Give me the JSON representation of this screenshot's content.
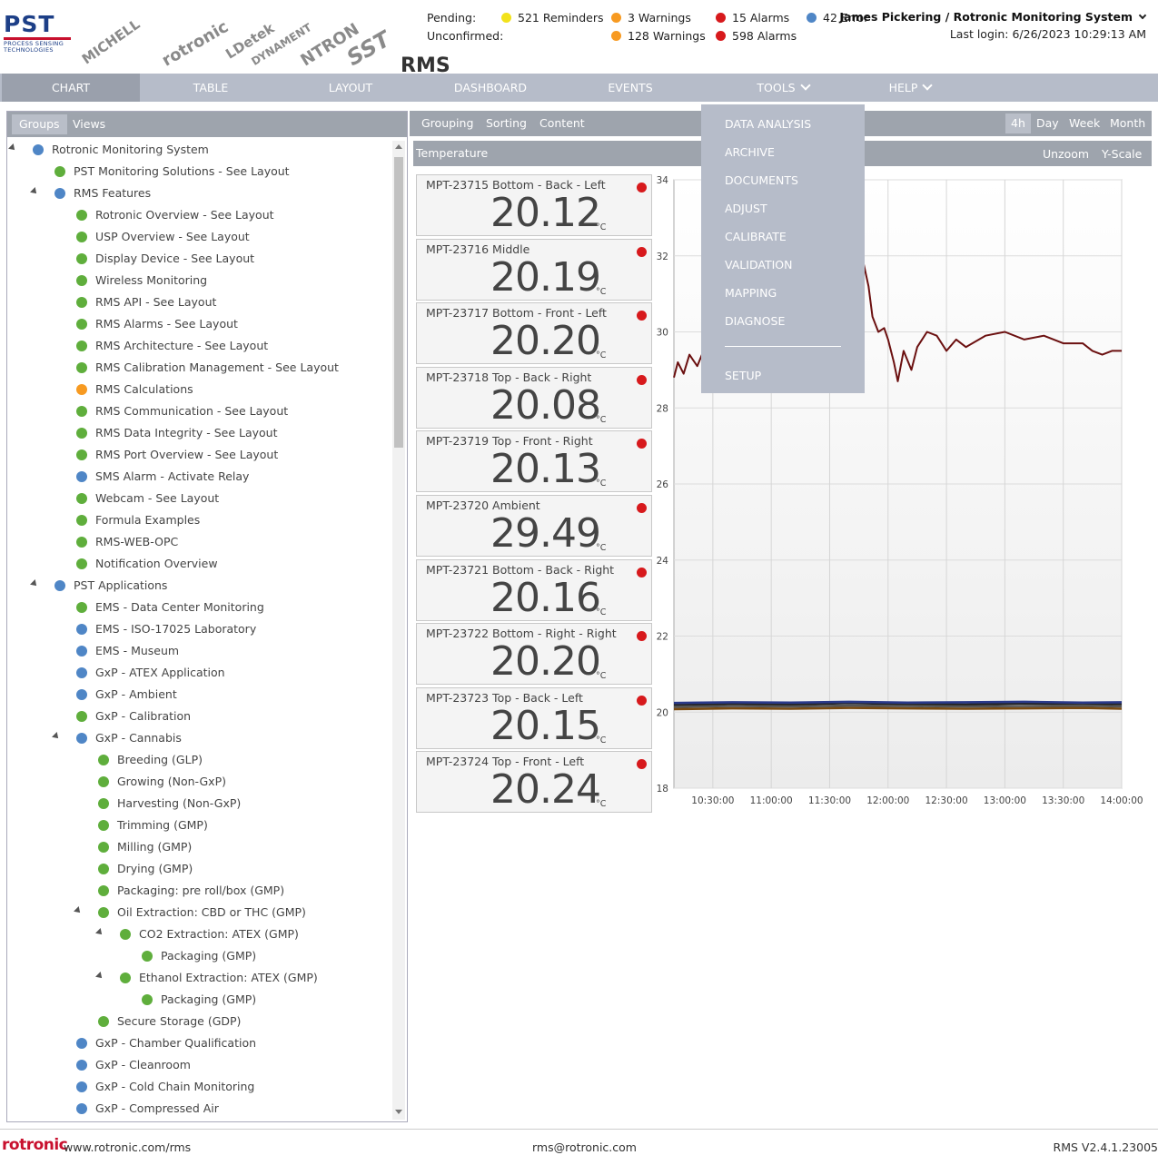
{
  "header": {
    "rms_title": "RMS",
    "pst_logo": {
      "name": "PST",
      "line1": "PROCESS SENSING",
      "line2": "TECHNOLOGIES"
    },
    "brand_logos": [
      "MICHELL",
      "rotronic",
      "LDetek",
      "DYNAMENT",
      "NTRON",
      "SST"
    ],
    "pending_label": "Pending:",
    "unconfirmed_label": "Unconfirmed:",
    "pending": {
      "reminders": "521 Reminders",
      "warnings": "3 Warnings",
      "alarms": "15 Alarms",
      "errors": "42 Error"
    },
    "unconfirmed": {
      "warnings": "128 Warnings",
      "alarms": "598 Alarms"
    },
    "user": "James Pickering / Rotronic Monitoring System",
    "last_login": "Last login: 6/26/2023 10:29:13 AM"
  },
  "colors": {
    "reminder": "#f2e21b",
    "warning": "#f79a21",
    "alarm": "#d7191c",
    "error": "#4f86c6",
    "ok": "#5fae3c",
    "nav": "#b6bcc9",
    "nav_active": "#9aa0ac"
  },
  "nav": {
    "chart": "CHART",
    "table": "TABLE",
    "layout": "LAYOUT",
    "dashboard": "DASHBOARD",
    "events": "EVENTS",
    "tools": "TOOLS",
    "help": "HELP"
  },
  "left_tabs": {
    "groups": "Groups",
    "views": "Views"
  },
  "tree": [
    {
      "label": "Rotronic Monitoring System",
      "level": 0,
      "status": "error",
      "expanded": true
    },
    {
      "label": "PST Monitoring Solutions - See Layout",
      "level": 1,
      "status": "ok"
    },
    {
      "label": "RMS Features",
      "level": 1,
      "status": "error",
      "expanded": true
    },
    {
      "label": "Rotronic Overview - See Layout",
      "level": 2,
      "status": "ok"
    },
    {
      "label": "USP Overview - See Layout",
      "level": 2,
      "status": "ok"
    },
    {
      "label": "Display Device - See Layout",
      "level": 2,
      "status": "ok"
    },
    {
      "label": "Wireless Monitoring",
      "level": 2,
      "status": "ok"
    },
    {
      "label": "RMS API - See Layout",
      "level": 2,
      "status": "ok"
    },
    {
      "label": "RMS Alarms - See Layout",
      "level": 2,
      "status": "ok"
    },
    {
      "label": "RMS Architecture - See Layout",
      "level": 2,
      "status": "ok"
    },
    {
      "label": "RMS Calibration Management - See Layout",
      "level": 2,
      "status": "ok"
    },
    {
      "label": "RMS Calculations",
      "level": 2,
      "status": "warning"
    },
    {
      "label": "RMS Communication - See Layout",
      "level": 2,
      "status": "ok"
    },
    {
      "label": "RMS Data Integrity - See Layout",
      "level": 2,
      "status": "ok"
    },
    {
      "label": "RMS Port Overview - See Layout",
      "level": 2,
      "status": "ok"
    },
    {
      "label": "SMS Alarm - Activate Relay",
      "level": 2,
      "status": "error"
    },
    {
      "label": "Webcam - See Layout",
      "level": 2,
      "status": "ok"
    },
    {
      "label": "Formula Examples",
      "level": 2,
      "status": "ok"
    },
    {
      "label": "RMS-WEB-OPC",
      "level": 2,
      "status": "ok"
    },
    {
      "label": "Notification Overview",
      "level": 2,
      "status": "ok"
    },
    {
      "label": "PST Applications",
      "level": 1,
      "status": "error",
      "expanded": true
    },
    {
      "label": "EMS - Data Center Monitoring",
      "level": 2,
      "status": "ok"
    },
    {
      "label": "EMS - ISO-17025 Laboratory",
      "level": 2,
      "status": "error"
    },
    {
      "label": "EMS - Museum",
      "level": 2,
      "status": "error"
    },
    {
      "label": "GxP - ATEX Application",
      "level": 2,
      "status": "error"
    },
    {
      "label": "GxP - Ambient",
      "level": 2,
      "status": "error"
    },
    {
      "label": "GxP - Calibration",
      "level": 2,
      "status": "ok"
    },
    {
      "label": "GxP - Cannabis",
      "level": 2,
      "status": "error",
      "expanded": true
    },
    {
      "label": "Breeding (GLP)",
      "level": 3,
      "status": "ok"
    },
    {
      "label": "Growing (Non-GxP)",
      "level": 3,
      "status": "ok"
    },
    {
      "label": "Harvesting (Non-GxP)",
      "level": 3,
      "status": "ok"
    },
    {
      "label": "Trimming (GMP)",
      "level": 3,
      "status": "ok"
    },
    {
      "label": "Milling (GMP)",
      "level": 3,
      "status": "ok"
    },
    {
      "label": "Drying (GMP)",
      "level": 3,
      "status": "ok"
    },
    {
      "label": "Packaging: pre roll/box (GMP)",
      "level": 3,
      "status": "ok"
    },
    {
      "label": "Oil Extraction: CBD or THC (GMP)",
      "level": 3,
      "status": "ok",
      "expanded": true
    },
    {
      "label": "CO2 Extraction: ATEX (GMP)",
      "level": 4,
      "status": "ok",
      "expanded": true
    },
    {
      "label": "Packaging (GMP)",
      "level": 5,
      "status": "ok"
    },
    {
      "label": "Ethanol Extraction: ATEX (GMP)",
      "level": 4,
      "status": "ok",
      "expanded": true
    },
    {
      "label": "Packaging (GMP)",
      "level": 5,
      "status": "ok"
    },
    {
      "label": "Secure Storage (GDP)",
      "level": 3,
      "status": "ok"
    },
    {
      "label": "GxP - Chamber Qualification",
      "level": 2,
      "status": "error"
    },
    {
      "label": "GxP - Cleanroom",
      "level": 2,
      "status": "error"
    },
    {
      "label": "GxP - Cold Chain Monitoring",
      "level": 2,
      "status": "error"
    },
    {
      "label": "GxP - Compressed Air",
      "level": 2,
      "status": "error"
    }
  ],
  "toolbar": {
    "grouping": "Grouping",
    "sorting": "Sorting",
    "content": "Content",
    "r4h": "4h",
    "day": "Day",
    "week": "Week",
    "month": "Month"
  },
  "chartbar": {
    "title": "Temperature",
    "unzoom": "Unzoom",
    "yscale": "Y-Scale"
  },
  "cards": [
    {
      "name": "MPT-23715 Bottom - Back - Left",
      "value": "20.12",
      "unit": "°C"
    },
    {
      "name": "MPT-23716 Middle",
      "value": "20.19",
      "unit": "°C"
    },
    {
      "name": "MPT-23717 Bottom - Front - Left",
      "value": "20.20",
      "unit": "°C"
    },
    {
      "name": "MPT-23718 Top - Back - Right",
      "value": "20.08",
      "unit": "°C"
    },
    {
      "name": "MPT-23719 Top - Front - Right",
      "value": "20.13",
      "unit": "°C"
    },
    {
      "name": "MPT-23720 Ambient",
      "value": "29.49",
      "unit": "°C"
    },
    {
      "name": "MPT-23721 Bottom - Back - Right",
      "value": "20.16",
      "unit": "°C"
    },
    {
      "name": "MPT-23722 Bottom - Right - Right",
      "value": "20.20",
      "unit": "°C"
    },
    {
      "name": "MPT-23723 Top - Back - Left",
      "value": "20.15",
      "unit": "°C"
    },
    {
      "name": "MPT-23724 Top - Front - Left",
      "value": "20.24",
      "unit": "°C"
    }
  ],
  "chart_data": {
    "type": "line",
    "ylim": [
      18,
      34
    ],
    "yticks": [
      18,
      20,
      22,
      24,
      26,
      28,
      30,
      32,
      34
    ],
    "xlim": [
      "10:10:00",
      "14:00:00"
    ],
    "xticks": [
      "10:30:00",
      "11:00:00",
      "11:30:00",
      "12:00:00",
      "12:30:00",
      "13:00:00",
      "13:30:00",
      "14:00:00"
    ],
    "grid": true,
    "series": [
      {
        "color": "#6b1010",
        "x": [
          "10:10:00",
          "10:12:00",
          "10:15:00",
          "10:18:00",
          "10:22:00",
          "10:26:00",
          "11:45:00",
          "11:47:00",
          "11:50:00",
          "11:52:00",
          "11:55:00",
          "11:58:00",
          "12:00:00",
          "12:03:00",
          "12:05:00",
          "12:08:00",
          "12:12:00",
          "12:15:00",
          "12:20:00",
          "12:25:00",
          "12:30:00",
          "12:35:00",
          "12:40:00",
          "12:50:00",
          "13:00:00",
          "13:10:00",
          "13:20:00",
          "13:30:00",
          "13:40:00",
          "13:45:00",
          "13:50:00",
          "13:55:00",
          "14:00:00"
        ],
        "values": [
          28.8,
          29.2,
          28.9,
          29.4,
          29.1,
          29.6,
          32.3,
          31.9,
          31.2,
          30.4,
          30.0,
          30.1,
          29.8,
          29.2,
          28.7,
          29.5,
          29.0,
          29.6,
          30.0,
          29.9,
          29.5,
          29.8,
          29.6,
          29.9,
          30.0,
          29.8,
          29.9,
          29.7,
          29.7,
          29.5,
          29.4,
          29.5,
          29.5
        ]
      },
      {
        "color": "#222222",
        "x": [
          "10:10:00",
          "10:40:00",
          "11:10:00",
          "11:40:00",
          "12:10:00",
          "12:40:00",
          "13:10:00",
          "13:40:00",
          "14:00:00"
        ],
        "values": [
          20.18,
          20.22,
          20.2,
          20.24,
          20.21,
          20.2,
          20.23,
          20.22,
          20.21
        ]
      },
      {
        "color": "#2a3a8a",
        "x": [
          "10:10:00",
          "10:40:00",
          "11:10:00",
          "11:40:00",
          "12:10:00",
          "12:40:00",
          "13:10:00",
          "13:40:00",
          "14:00:00"
        ],
        "values": [
          20.24,
          20.26,
          20.25,
          20.27,
          20.25,
          20.26,
          20.27,
          20.25,
          20.26
        ]
      },
      {
        "color": "#7a4a10",
        "x": [
          "10:10:00",
          "10:40:00",
          "11:10:00",
          "11:40:00",
          "12:10:00",
          "12:40:00",
          "13:10:00",
          "13:40:00",
          "14:00:00"
        ],
        "values": [
          20.08,
          20.1,
          20.09,
          20.11,
          20.1,
          20.09,
          20.1,
          20.11,
          20.09
        ]
      },
      {
        "color": "#555555",
        "x": [
          "10:10:00",
          "10:40:00",
          "11:10:00",
          "11:40:00",
          "12:10:00",
          "12:40:00",
          "13:10:00",
          "13:40:00",
          "14:00:00"
        ],
        "values": [
          20.14,
          20.16,
          20.15,
          20.17,
          20.16,
          20.15,
          20.16,
          20.17,
          20.15
        ]
      }
    ]
  },
  "tools_menu": {
    "items": [
      "DATA ANALYSIS",
      "ARCHIVE",
      "DOCUMENTS",
      "ADJUST",
      "CALIBRATE",
      "VALIDATION",
      "MAPPING",
      "DIAGNOSE"
    ],
    "setup": "SETUP"
  },
  "footer": {
    "logo": "rotronic",
    "website": "www.rotronic.com/rms",
    "email": "rms@rotronic.com",
    "version": "RMS V2.4.1.23005"
  }
}
